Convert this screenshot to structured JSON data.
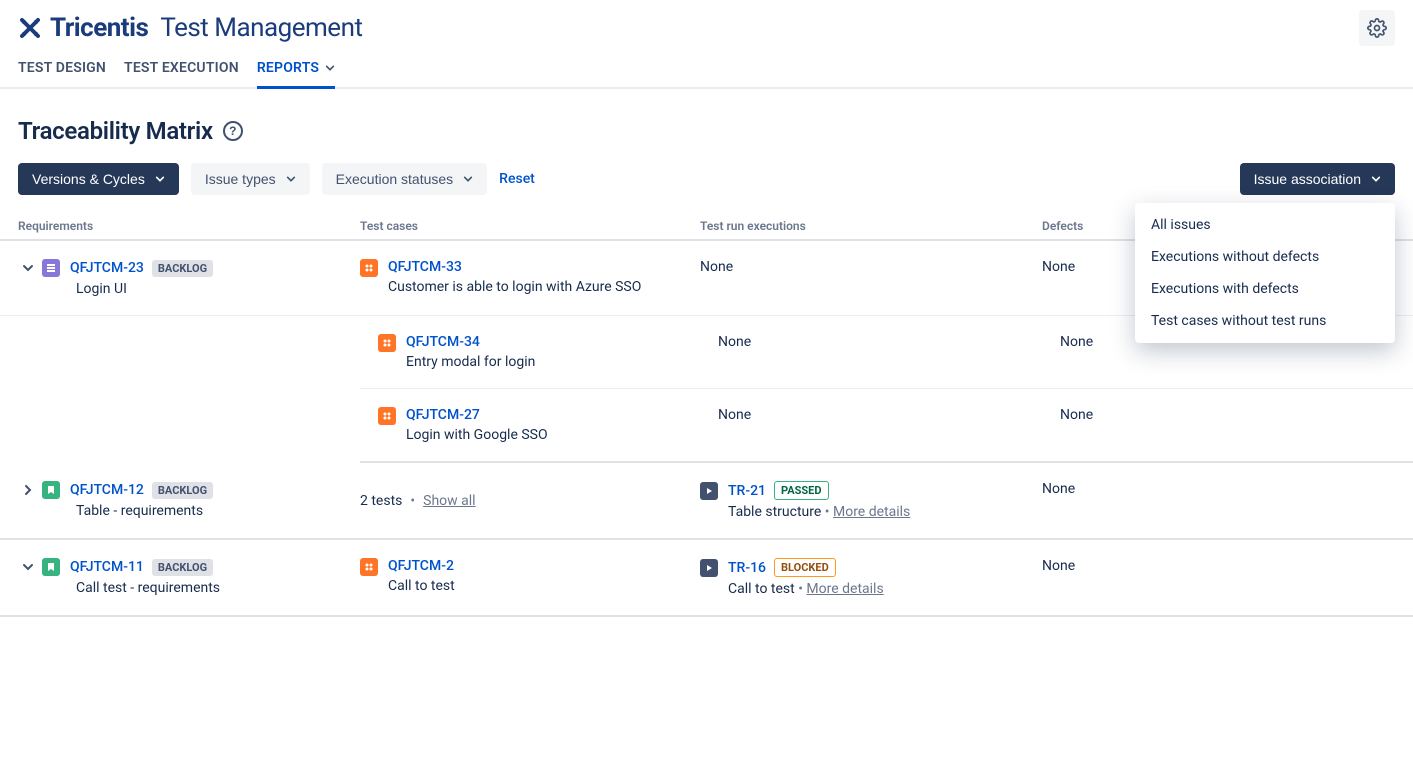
{
  "header": {
    "brand_text": "Tricentis",
    "app_name": "Test Management"
  },
  "nav": {
    "tabs": [
      "TEST DESIGN",
      "TEST EXECUTION",
      "REPORTS"
    ],
    "active": 2
  },
  "page": {
    "title": "Traceability Matrix"
  },
  "filters": {
    "versions": "Versions & Cycles",
    "issue_types": "Issue types",
    "exec_statuses": "Execution statuses",
    "reset": "Reset",
    "issue_assoc": "Issue association"
  },
  "issue_assoc_menu": [
    "All issues",
    "Executions without defects",
    "Executions with defects",
    "Test cases without test runs"
  ],
  "columns": {
    "req": "Requirements",
    "tc": "Test cases",
    "exec": "Test run executions",
    "def": "Defects"
  },
  "groups": [
    {
      "expanded": true,
      "req_icon_color": "purple",
      "req_key": "QFJTCM-23",
      "req_status": "BACKLOG",
      "req_title": "Login UI",
      "testcases": [
        {
          "key": "QFJTCM-33",
          "title": "Customer is able to login with Azure SSO",
          "exec": "None",
          "defects": "None"
        },
        {
          "key": "QFJTCM-34",
          "title": "Entry modal for login",
          "exec": "None",
          "defects": "None"
        },
        {
          "key": "QFJTCM-27",
          "title": "Login with Google SSO",
          "exec": "None",
          "defects": "None"
        }
      ]
    },
    {
      "expanded": false,
      "req_icon_color": "green",
      "req_key": "QFJTCM-12",
      "req_status": "BACKLOG",
      "req_title": "Table - requirements",
      "tests_summary": "2 tests",
      "show_all": "Show all",
      "exec": {
        "run_key": "TR-21",
        "run_status": "PASSED",
        "run_title": "Table structure",
        "more": "More details"
      },
      "defects": "None"
    },
    {
      "expanded": true,
      "req_icon_color": "green",
      "req_key": "QFJTCM-11",
      "req_status": "BACKLOG",
      "req_title": "Call test - requirements",
      "testcases": [
        {
          "key": "QFJTCM-2",
          "title": "Call to test",
          "exec_run": {
            "run_key": "TR-16",
            "run_status": "BLOCKED",
            "run_title": "Call to test",
            "more": "More details"
          },
          "defects": "None"
        }
      ]
    }
  ]
}
